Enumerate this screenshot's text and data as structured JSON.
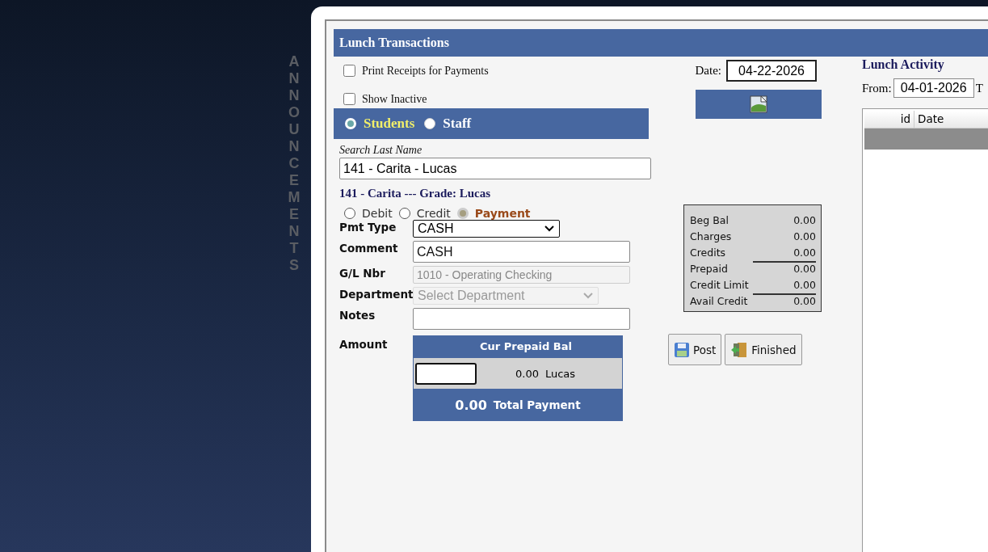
{
  "background": {
    "vertical_label": "ANNOUNCEMENTS"
  },
  "panel": {
    "title": "Lunch Transactions"
  },
  "options": [
    {
      "label": "Print Receipts for Payments",
      "checked": false
    },
    {
      "label": "Show Inactive",
      "checked": false
    }
  ],
  "person_type": [
    {
      "label": "Students",
      "selected": true
    },
    {
      "label": "Staff",
      "selected": false
    }
  ],
  "search": {
    "label": "Search Last Name",
    "value": "141 - Carita - Lucas"
  },
  "student_line": "141 - Carita --- Grade: Lucas",
  "transaction_type": [
    {
      "label": "Debit",
      "selected": false
    },
    {
      "label": "Credit",
      "selected": false
    },
    {
      "label": "Payment",
      "selected": true
    }
  ],
  "form": [
    {
      "label": "Pmt Type",
      "kind": "select",
      "value": "CASH",
      "disabled": false
    },
    {
      "label": "Comment",
      "kind": "input",
      "value": "CASH",
      "disabled": false
    },
    {
      "label": "G/L Nbr",
      "kind": "input",
      "value": "1010 - Operating Checking",
      "disabled": true
    },
    {
      "label": "Department",
      "kind": "select",
      "placeholder": "Select Department",
      "disabled": true
    },
    {
      "label": "Notes",
      "kind": "input",
      "disabled": false
    }
  ],
  "amount": {
    "label": "Amount",
    "header": "Cur Prepaid Bal",
    "rows": [
      {
        "balance": "0.00",
        "name": "Lucas"
      }
    ],
    "total": "0.00",
    "total_label": "Total Payment"
  },
  "date": {
    "label": "Date:",
    "value": "04-22-2026"
  },
  "summary": [
    {
      "label": "Beg Bal",
      "value": "0.00",
      "rule_above": false
    },
    {
      "label": "Charges",
      "value": "0.00",
      "rule_above": false
    },
    {
      "label": "Credits",
      "value": "0.00",
      "rule_above": false
    },
    {
      "label": "Prepaid",
      "value": "0.00",
      "rule_above": true
    },
    {
      "label": "Credit Limit",
      "value": "0.00",
      "rule_above": false
    },
    {
      "label": "Avail Credit",
      "value": "0.00",
      "rule_above": true
    }
  ],
  "buttons": [
    {
      "label": "Post",
      "kind": "save"
    },
    {
      "label": "Finished",
      "kind": "exit"
    }
  ],
  "activity": {
    "title": "Lunch Activity",
    "from_label": "From:",
    "from_value": "04-01-2026",
    "to_label": "T",
    "columns": [
      "id",
      "Date"
    ]
  }
}
